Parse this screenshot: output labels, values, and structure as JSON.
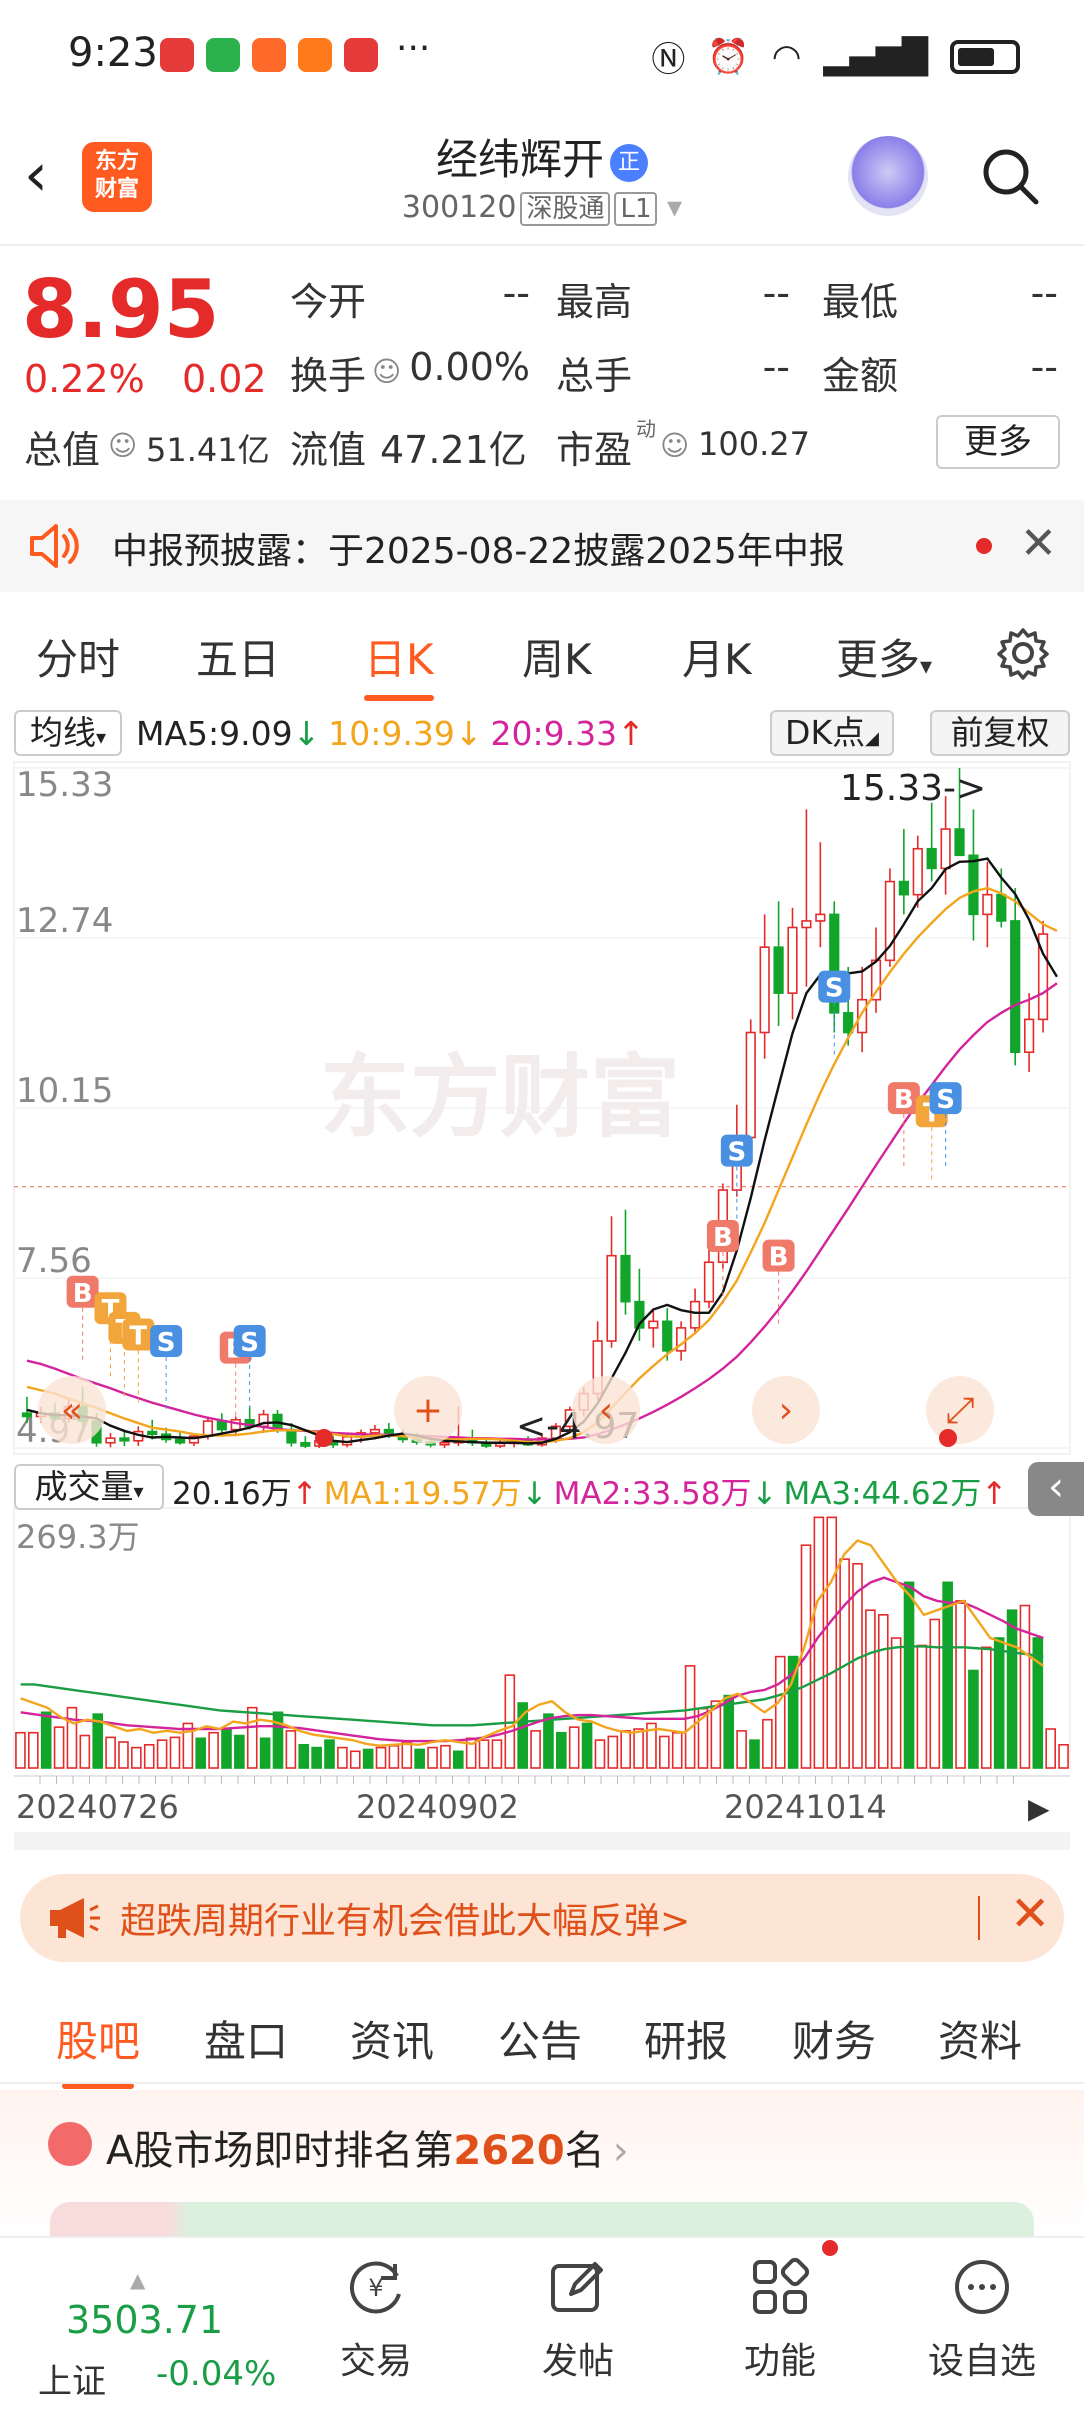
{
  "status_bar": {
    "time": "9:23",
    "more": "···"
  },
  "header": {
    "logo_text_1": "东方",
    "logo_text_2": "财富",
    "stock_name": "经纬辉开",
    "badge": "正",
    "code": "300120",
    "tag1": "深股通",
    "tag2": "L1"
  },
  "quote": {
    "price": "8.95",
    "change_pct": "0.22%",
    "change": "0.02",
    "items": [
      {
        "label": "今开",
        "value": "--"
      },
      {
        "label": "最高",
        "value": "--"
      },
      {
        "label": "最低",
        "value": "--"
      },
      {
        "label": "换手",
        "value": "0.00%"
      },
      {
        "label": "总手",
        "value": "--"
      },
      {
        "label": "金额",
        "value": "--"
      },
      {
        "label": "总值",
        "value": "51.41亿"
      },
      {
        "label": "流值",
        "value": "47.21亿"
      },
      {
        "label": "市盈",
        "sup": "动",
        "value": "100.27"
      }
    ],
    "more_label": "更多"
  },
  "notice": {
    "text": "中报预披露：于2025-08-22披露2025年中报"
  },
  "tabs": [
    "分时",
    "五日",
    "日K",
    "周K",
    "月K",
    "更多"
  ],
  "active_tab": "日K",
  "ma_bar": {
    "type_label": "均线",
    "ma5": "MA5:9.09",
    "ma10": "10:9.39",
    "ma20": "20:9.33",
    "dk_label": "DK点",
    "adj_label": "前复权",
    "colors": {
      "ma5": "#111111",
      "ma10": "#f2a51d",
      "ma20": "#d4249b"
    }
  },
  "chart_data": [
    {
      "type": "candlestick",
      "title": "",
      "y_ticks": [
        "15.33",
        "12.74",
        "10.15",
        "7.56",
        "4.97"
      ],
      "ylim": [
        4.97,
        15.33
      ],
      "annotations": {
        "high": "15.33->",
        "low": "<-4.97"
      },
      "watermark": "东方财富",
      "x_ticks": [
        "20240726",
        "20240902",
        "20241014"
      ],
      "candles": [
        {
          "o": 5.5,
          "h": 5.75,
          "l": 5.35,
          "c": 5.45
        },
        {
          "o": 5.45,
          "h": 5.6,
          "l": 5.35,
          "c": 5.5
        },
        {
          "o": 5.5,
          "h": 5.65,
          "l": 5.4,
          "c": 5.42
        },
        {
          "o": 5.42,
          "h": 5.7,
          "l": 5.35,
          "c": 5.6
        },
        {
          "o": 5.6,
          "h": 5.9,
          "l": 5.3,
          "c": 5.38
        },
        {
          "o": 5.38,
          "h": 5.5,
          "l": 4.99,
          "c": 5.05
        },
        {
          "o": 5.05,
          "h": 5.2,
          "l": 4.98,
          "c": 5.12
        },
        {
          "o": 5.12,
          "h": 5.25,
          "l": 5.0,
          "c": 5.08
        },
        {
          "o": 5.08,
          "h": 5.3,
          "l": 5.0,
          "c": 5.22
        },
        {
          "o": 5.22,
          "h": 5.4,
          "l": 5.1,
          "c": 5.18
        },
        {
          "o": 5.18,
          "h": 5.28,
          "l": 5.05,
          "c": 5.1
        },
        {
          "o": 5.1,
          "h": 5.22,
          "l": 5.02,
          "c": 5.05
        },
        {
          "o": 5.05,
          "h": 5.18,
          "l": 5.0,
          "c": 5.15
        },
        {
          "o": 5.15,
          "h": 5.45,
          "l": 5.1,
          "c": 5.38
        },
        {
          "o": 5.38,
          "h": 5.5,
          "l": 5.2,
          "c": 5.25
        },
        {
          "o": 5.25,
          "h": 5.45,
          "l": 5.15,
          "c": 5.4
        },
        {
          "o": 5.4,
          "h": 5.6,
          "l": 5.25,
          "c": 5.3
        },
        {
          "o": 5.3,
          "h": 5.55,
          "l": 5.2,
          "c": 5.48
        },
        {
          "o": 5.48,
          "h": 5.55,
          "l": 5.2,
          "c": 5.25
        },
        {
          "o": 5.25,
          "h": 5.35,
          "l": 4.99,
          "c": 5.05
        },
        {
          "o": 5.05,
          "h": 5.15,
          "l": 4.97,
          "c": 5.0
        },
        {
          "o": 5.0,
          "h": 5.12,
          "l": 4.97,
          "c": 5.08
        },
        {
          "o": 5.08,
          "h": 5.15,
          "l": 4.97,
          "c": 5.02
        },
        {
          "o": 5.02,
          "h": 5.2,
          "l": 4.98,
          "c": 5.14
        },
        {
          "o": 5.14,
          "h": 5.25,
          "l": 5.05,
          "c": 5.2
        },
        {
          "o": 5.2,
          "h": 5.32,
          "l": 5.1,
          "c": 5.25
        },
        {
          "o": 5.25,
          "h": 5.35,
          "l": 5.12,
          "c": 5.18
        },
        {
          "o": 5.18,
          "h": 5.26,
          "l": 5.05,
          "c": 5.1
        },
        {
          "o": 5.1,
          "h": 5.2,
          "l": 5.02,
          "c": 5.06
        },
        {
          "o": 5.06,
          "h": 5.14,
          "l": 4.98,
          "c": 5.02
        },
        {
          "o": 5.02,
          "h": 5.1,
          "l": 4.97,
          "c": 5.05
        },
        {
          "o": 5.05,
          "h": 5.6,
          "l": 5.0,
          "c": 5.1
        },
        {
          "o": 5.1,
          "h": 5.25,
          "l": 5.0,
          "c": 5.05
        },
        {
          "o": 5.05,
          "h": 5.12,
          "l": 4.97,
          "c": 5.0
        },
        {
          "o": 5.0,
          "h": 5.1,
          "l": 4.97,
          "c": 5.04
        },
        {
          "o": 5.04,
          "h": 5.12,
          "l": 4.98,
          "c": 5.08
        },
        {
          "o": 5.08,
          "h": 5.15,
          "l": 5.0,
          "c": 5.02
        },
        {
          "o": 5.02,
          "h": 5.2,
          "l": 4.99,
          "c": 5.12
        },
        {
          "o": 5.12,
          "h": 5.35,
          "l": 5.05,
          "c": 5.3
        },
        {
          "o": 5.3,
          "h": 5.6,
          "l": 5.25,
          "c": 5.55
        },
        {
          "o": 5.55,
          "h": 5.9,
          "l": 5.45,
          "c": 5.8
        },
        {
          "o": 5.8,
          "h": 6.9,
          "l": 5.7,
          "c": 6.6
        },
        {
          "o": 6.6,
          "h": 8.5,
          "l": 6.5,
          "c": 7.9
        },
        {
          "o": 7.9,
          "h": 8.6,
          "l": 7.0,
          "c": 7.2
        },
        {
          "o": 7.2,
          "h": 7.7,
          "l": 6.6,
          "c": 6.8
        },
        {
          "o": 6.8,
          "h": 7.1,
          "l": 6.5,
          "c": 6.9
        },
        {
          "o": 6.9,
          "h": 7.1,
          "l": 6.3,
          "c": 6.45
        },
        {
          "o": 6.45,
          "h": 6.9,
          "l": 6.3,
          "c": 6.8
        },
        {
          "o": 6.8,
          "h": 7.4,
          "l": 6.7,
          "c": 7.2
        },
        {
          "o": 7.2,
          "h": 8.0,
          "l": 7.1,
          "c": 7.8
        },
        {
          "o": 7.8,
          "h": 9.0,
          "l": 7.7,
          "c": 8.9
        },
        {
          "o": 8.9,
          "h": 10.2,
          "l": 8.8,
          "c": 9.7
        },
        {
          "o": 9.7,
          "h": 11.5,
          "l": 9.6,
          "c": 11.3
        },
        {
          "o": 11.3,
          "h": 13.1,
          "l": 10.9,
          "c": 12.6
        },
        {
          "o": 12.6,
          "h": 13.3,
          "l": 11.4,
          "c": 11.9
        },
        {
          "o": 11.9,
          "h": 13.2,
          "l": 11.5,
          "c": 12.9
        },
        {
          "o": 12.9,
          "h": 14.7,
          "l": 12.0,
          "c": 13.0
        },
        {
          "o": 13.0,
          "h": 14.2,
          "l": 12.6,
          "c": 13.1
        },
        {
          "o": 13.1,
          "h": 13.3,
          "l": 11.3,
          "c": 11.6
        },
        {
          "o": 11.6,
          "h": 12.3,
          "l": 11.1,
          "c": 11.3
        },
        {
          "o": 11.3,
          "h": 12.3,
          "l": 11.0,
          "c": 11.8
        },
        {
          "o": 11.8,
          "h": 12.9,
          "l": 11.6,
          "c": 12.4
        },
        {
          "o": 12.4,
          "h": 13.8,
          "l": 12.3,
          "c": 13.6
        },
        {
          "o": 13.6,
          "h": 14.4,
          "l": 13.1,
          "c": 13.4
        },
        {
          "o": 13.4,
          "h": 14.3,
          "l": 13.2,
          "c": 14.1
        },
        {
          "o": 14.1,
          "h": 14.8,
          "l": 13.6,
          "c": 13.8
        },
        {
          "o": 13.8,
          "h": 14.9,
          "l": 13.4,
          "c": 14.4
        },
        {
          "o": 14.4,
          "h": 15.33,
          "l": 14.0,
          "c": 14.0
        },
        {
          "o": 14.0,
          "h": 14.7,
          "l": 12.7,
          "c": 13.1
        },
        {
          "o": 13.1,
          "h": 13.9,
          "l": 12.6,
          "c": 13.4
        },
        {
          "o": 13.4,
          "h": 13.8,
          "l": 12.9,
          "c": 13.0
        },
        {
          "o": 13.0,
          "h": 13.5,
          "l": 10.8,
          "c": 11.0
        },
        {
          "o": 11.0,
          "h": 11.9,
          "l": 10.7,
          "c": 11.5
        },
        {
          "o": 11.5,
          "h": 13.0,
          "l": 11.3,
          "c": 12.8
        }
      ],
      "ma5": [
        5.55,
        5.5,
        5.47,
        5.47,
        5.45,
        5.42,
        5.31,
        5.23,
        5.17,
        5.13,
        5.14,
        5.13,
        5.12,
        5.15,
        5.19,
        5.23,
        5.28,
        5.35,
        5.36,
        5.32,
        5.24,
        5.16,
        5.08,
        5.06,
        5.09,
        5.12,
        5.16,
        5.19,
        5.16,
        5.11,
        5.08,
        5.07,
        5.06,
        5.05,
        5.05,
        5.05,
        5.04,
        5.05,
        5.11,
        5.21,
        5.37,
        5.65,
        6.03,
        6.42,
        6.86,
        7.08,
        7.15,
        7.07,
        7.03,
        7.03,
        7.34,
        7.98,
        8.78,
        9.66,
        10.48,
        11.29,
        11.9,
        12.18,
        12.22,
        12.2,
        12.23,
        12.38,
        12.62,
        12.95,
        13.3,
        13.5,
        13.79,
        13.9,
        13.91,
        13.95,
        13.66,
        13.41,
        13.02,
        12.5,
        12.15
      ],
      "ma10": [
        5.9,
        5.85,
        5.8,
        5.72,
        5.65,
        5.58,
        5.5,
        5.42,
        5.35,
        5.28,
        5.25,
        5.22,
        5.18,
        5.16,
        5.16,
        5.17,
        5.19,
        5.22,
        5.24,
        5.24,
        5.24,
        5.2,
        5.18,
        5.15,
        5.14,
        5.16,
        5.16,
        5.15,
        5.13,
        5.11,
        5.1,
        5.1,
        5.11,
        5.11,
        5.1,
        5.08,
        5.06,
        5.06,
        5.08,
        5.12,
        5.21,
        5.36,
        5.58,
        5.81,
        6.03,
        6.22,
        6.4,
        6.55,
        6.72,
        6.92,
        7.2,
        7.52,
        7.95,
        8.4,
        8.9,
        9.4,
        9.9,
        10.38,
        10.82,
        11.22,
        11.6,
        11.92,
        12.22,
        12.5,
        12.75,
        12.97,
        13.18,
        13.35,
        13.45,
        13.5,
        13.42,
        13.3,
        13.12,
        12.95,
        12.85
      ],
      "ma20": [
        6.3,
        6.25,
        6.18,
        6.1,
        6.02,
        5.95,
        5.88,
        5.8,
        5.73,
        5.66,
        5.6,
        5.54,
        5.48,
        5.43,
        5.39,
        5.35,
        5.32,
        5.29,
        5.26,
        5.24,
        5.23,
        5.22,
        5.2,
        5.19,
        5.18,
        5.17,
        5.17,
        5.17,
        5.16,
        5.15,
        5.14,
        5.13,
        5.12,
        5.12,
        5.11,
        5.11,
        5.1,
        5.1,
        5.1,
        5.11,
        5.13,
        5.18,
        5.25,
        5.33,
        5.42,
        5.52,
        5.63,
        5.75,
        5.88,
        6.02,
        6.18,
        6.36,
        6.58,
        6.82,
        7.08,
        7.36,
        7.66,
        7.98,
        8.3,
        8.62,
        8.95,
        9.28,
        9.6,
        9.92,
        10.22,
        10.5,
        10.78,
        11.04,
        11.26,
        11.46,
        11.6,
        11.72,
        11.8,
        11.9,
        12.05
      ]
    },
    {
      "type": "bar",
      "title": "成交量",
      "y_ticks": [
        "269.3万"
      ],
      "ylim": [
        0,
        269.3
      ],
      "unit": "万",
      "values": [
        38,
        38,
        60,
        44,
        65,
        35,
        58,
        33,
        28,
        22,
        25,
        30,
        33,
        48,
        32,
        38,
        42,
        35,
        65,
        32,
        60,
        40,
        25,
        22,
        30,
        22,
        18,
        20,
        22,
        24,
        28,
        20,
        22,
        24,
        18,
        32,
        30,
        30,
        100,
        70,
        40,
        58,
        38,
        44,
        48,
        30,
        34,
        40,
        42,
        48,
        34,
        38,
        110,
        64,
        72,
        78,
        40,
        30,
        52,
        120,
        120,
        240,
        270,
        270,
        225,
        220,
        170,
        165,
        140,
        200,
        132,
        160,
        200,
        180,
        105,
        130,
        140,
        170,
        175,
        140,
        42,
        25
      ],
      "up": [
        true,
        true,
        false,
        true,
        true,
        true,
        false,
        true,
        true,
        true,
        true,
        true,
        true,
        true,
        false,
        true,
        false,
        false,
        true,
        false,
        false,
        true,
        false,
        false,
        false,
        true,
        true,
        false,
        true,
        true,
        true,
        false,
        true,
        true,
        false,
        true,
        true,
        true,
        true,
        false,
        true,
        false,
        false,
        true,
        false,
        true,
        true,
        true,
        true,
        true,
        true,
        true,
        true,
        true,
        true,
        false,
        true,
        false,
        true,
        true,
        false,
        true,
        true,
        true,
        true,
        true,
        true,
        true,
        true,
        false,
        true,
        true,
        false,
        true,
        false,
        true,
        false,
        false,
        true,
        false,
        true,
        true
      ],
      "ma1": [
        75,
        70,
        65,
        55,
        48,
        52,
        50,
        45,
        40,
        42,
        38,
        40,
        38,
        40,
        45,
        42,
        50,
        48,
        52,
        50,
        46,
        40,
        36,
        34,
        32,
        30,
        26,
        24,
        25,
        26,
        25,
        28,
        30,
        28,
        26,
        34,
        40,
        45,
        60,
        68,
        72,
        60,
        52,
        50,
        44,
        40,
        38,
        40,
        42,
        40,
        38,
        50,
        62,
        75,
        80,
        70,
        60,
        70,
        90,
        130,
        180,
        200,
        230,
        245,
        240,
        220,
        200,
        185,
        165,
        170,
        175,
        180,
        160,
        140,
        135,
        130,
        120,
        110
      ],
      "ma2": [
        60,
        58,
        56,
        54,
        52,
        51,
        50,
        48,
        46,
        45,
        44,
        43,
        42,
        42,
        42,
        42,
        43,
        44,
        45,
        45,
        44,
        43,
        41,
        39,
        37,
        35,
        33,
        31,
        30,
        29,
        29,
        29,
        29,
        30,
        31,
        33,
        36,
        40,
        45,
        50,
        54,
        56,
        57,
        57,
        56,
        55,
        54,
        53,
        53,
        53,
        53,
        56,
        62,
        70,
        78,
        82,
        84,
        90,
        100,
        118,
        140,
        158,
        175,
        190,
        200,
        205,
        200,
        195,
        185,
        180,
        178,
        178,
        172,
        165,
        158,
        150,
        145,
        140
      ],
      "ma3": [
        90,
        90,
        88,
        86,
        84,
        82,
        80,
        78,
        76,
        74,
        72,
        70,
        68,
        66,
        64,
        62,
        61,
        60,
        59,
        58,
        57,
        56,
        55,
        54,
        53,
        52,
        51,
        50,
        49,
        48,
        47,
        46,
        46,
        46,
        46,
        47,
        48,
        49,
        50,
        51,
        52,
        53,
        54,
        55,
        56,
        57,
        58,
        59,
        60,
        61,
        62,
        64,
        66,
        68,
        70,
        72,
        74,
        78,
        82,
        88,
        95,
        102,
        110,
        118,
        124,
        128,
        130,
        131,
        131,
        130,
        130,
        130,
        129,
        128,
        126,
        124,
        122,
        120
      ]
    }
  ],
  "volume_bar": {
    "type_label": "成交量",
    "vol": "20.16万",
    "ma1": "MA1:19.57万",
    "ma2": "MA2:33.58万",
    "ma3": "MA3:44.62万",
    "colors": {
      "ma1": "#f2a51d",
      "ma2": "#d4249b",
      "ma3": "#1a9e45"
    }
  },
  "ad": {
    "text": "超跌周期行业有机会借此大幅反弹>"
  },
  "bottom_tabs": [
    "股吧",
    "盘口",
    "资讯",
    "公告",
    "研报",
    "财务",
    "资料"
  ],
  "active_bottom_tab": "股吧",
  "rank": {
    "prefix": "A股市场即时排名第",
    "number": "2620",
    "suffix": "名"
  },
  "index": {
    "value": "3503.71",
    "name": "上证",
    "change": "-0.04%"
  },
  "nav": [
    {
      "label": "交易",
      "icon": "trade-icon"
    },
    {
      "label": "发帖",
      "icon": "post-icon"
    },
    {
      "label": "功能",
      "icon": "function-icon"
    },
    {
      "label": "设自选",
      "icon": "add-watchlist-icon"
    }
  ],
  "theme": {
    "up": "#e52a2a",
    "down": "#11a52a",
    "accent": "#ff5a1f"
  }
}
